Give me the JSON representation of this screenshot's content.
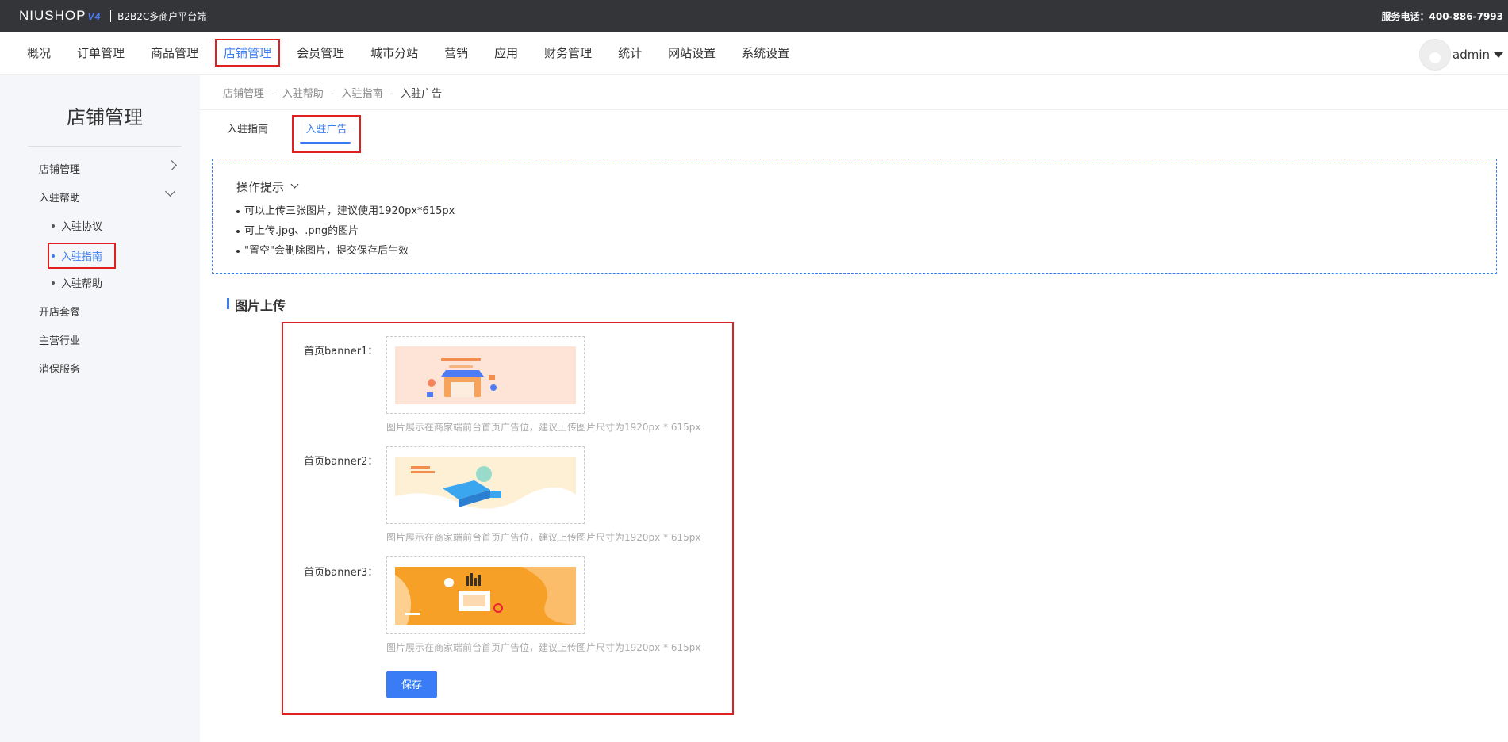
{
  "header": {
    "logo": "NIUSHOP",
    "logo_version": "V4",
    "subtitle": "B2B2C多商户平台端",
    "phone_label": "服务电话：",
    "phone": "400-886-7993"
  },
  "nav": {
    "items": [
      "概况",
      "订单管理",
      "商品管理",
      "店铺管理",
      "会员管理",
      "城市分站",
      "营销",
      "应用",
      "财务管理",
      "统计",
      "网站设置",
      "系统设置"
    ],
    "active_index": 3
  },
  "user": {
    "name": "admin"
  },
  "sidebar": {
    "title": "店铺管理",
    "items": [
      {
        "label": "店铺管理"
      },
      {
        "label": "入驻帮助"
      },
      {
        "label": "开店套餐"
      },
      {
        "label": "主营行业"
      },
      {
        "label": "消保服务"
      }
    ],
    "subitems": [
      {
        "label": "入驻协议"
      },
      {
        "label": "入驻指南"
      },
      {
        "label": "入驻帮助"
      }
    ]
  },
  "breadcrumb": [
    "店铺管理",
    "入驻帮助",
    "入驻指南",
    "入驻广告"
  ],
  "breadcrumb_sep": "-",
  "tabs": [
    {
      "label": "入驻指南"
    },
    {
      "label": "入驻广告"
    }
  ],
  "tips": {
    "title": "操作提示",
    "items": [
      "可以上传三张图片，建议使用1920px*615px",
      "可上传.jpg、.png的图片",
      "\"置空\"会删除图片，提交保存后生效"
    ]
  },
  "section": {
    "title": "图片上传"
  },
  "banners": [
    {
      "label": "首页banner1：",
      "hint": "图片展示在商家端前台首页广告位，建议上传图片尺寸为1920px * 615px",
      "bg": "#fde4d6",
      "accent": "#f6a35b"
    },
    {
      "label": "首页banner2：",
      "hint": "图片展示在商家端前台首页广告位，建议上传图片尺寸为1920px * 615px",
      "bg": "#fef0d4",
      "accent": "#3aa6f0"
    },
    {
      "label": "首页banner3：",
      "hint": "图片展示在商家端前台首页广告位，建议上传图片尺寸为1920px * 615px",
      "bg": "#f7a028",
      "accent": "#fdd090"
    }
  ],
  "save_label": "保存"
}
